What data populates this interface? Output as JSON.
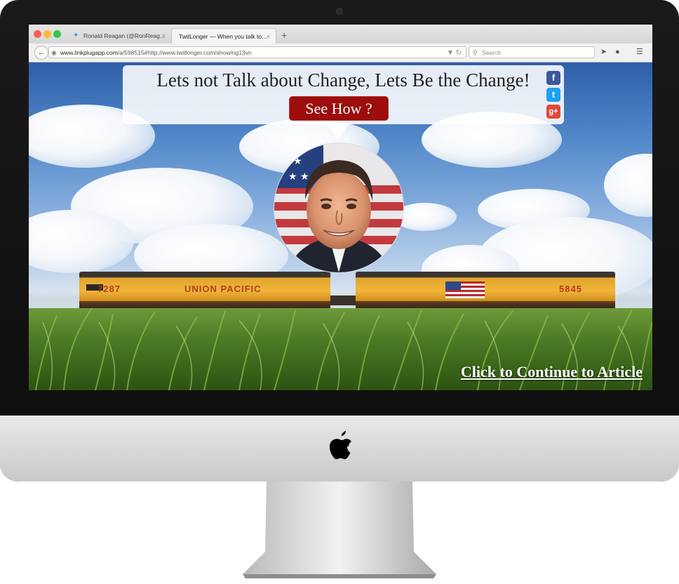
{
  "browser": {
    "tabs": [
      {
        "title": "Ronald Reagan (@RonReag…",
        "active": false
      },
      {
        "title": "TwitLonger — When you talk to…",
        "active": true
      }
    ],
    "new_tab_glyph": "+",
    "close_glyph": "×",
    "url_domain": "www.linkplugapp.com",
    "url_rest": "/a/598515#http://www.twitlonger.com/show/ng13vn",
    "search_placeholder": "Search"
  },
  "page": {
    "headline": "Lets not Talk about Change, Lets Be the Change!",
    "cta_button": "See How ?",
    "continue_link": "Click to Continue to Article",
    "social": [
      {
        "name": "facebook",
        "glyph": "f",
        "color": "#3b5998"
      },
      {
        "name": "twitter",
        "glyph": "t",
        "color": "#1da1f2"
      },
      {
        "name": "google-plus",
        "glyph": "g+",
        "color": "#dd4b39"
      }
    ],
    "train": {
      "left_number": "7287",
      "left_logo": "UNION PACIFIC",
      "right_number": "5845"
    }
  },
  "colors": {
    "cta_bg": "#9c0d0b",
    "traffic_red": "#fc5f57",
    "traffic_yellow": "#fdbc2e",
    "traffic_green": "#34c84a"
  }
}
